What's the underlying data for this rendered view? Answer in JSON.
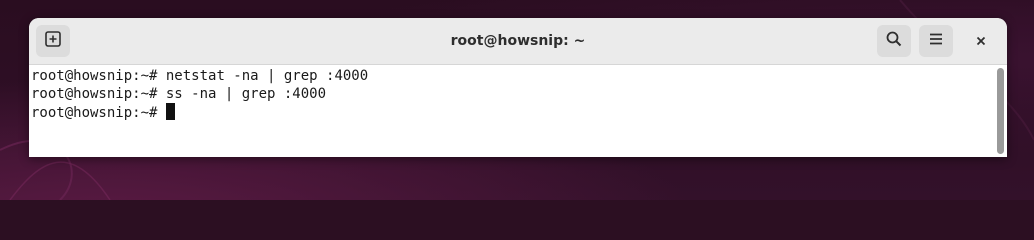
{
  "window": {
    "title": "root@howsnip: ~"
  },
  "titlebar": {
    "new_tab_icon": "new-tab-plus-icon",
    "search_icon": "search-icon",
    "menu_icon": "hamburger-menu-icon",
    "close_icon": "close-icon"
  },
  "terminal": {
    "lines": [
      {
        "prompt": "root@howsnip:~#",
        "command": " netstat -na | grep :4000"
      },
      {
        "prompt": "root@howsnip:~#",
        "command": " ss -na | grep :4000"
      },
      {
        "prompt": "root@howsnip:~#",
        "command": " "
      }
    ]
  },
  "colors": {
    "desktop_background": "#2c0f22",
    "titlebar": "#ebebeb",
    "terminal_background": "#ffffff",
    "terminal_text": "#1a1a1a"
  }
}
